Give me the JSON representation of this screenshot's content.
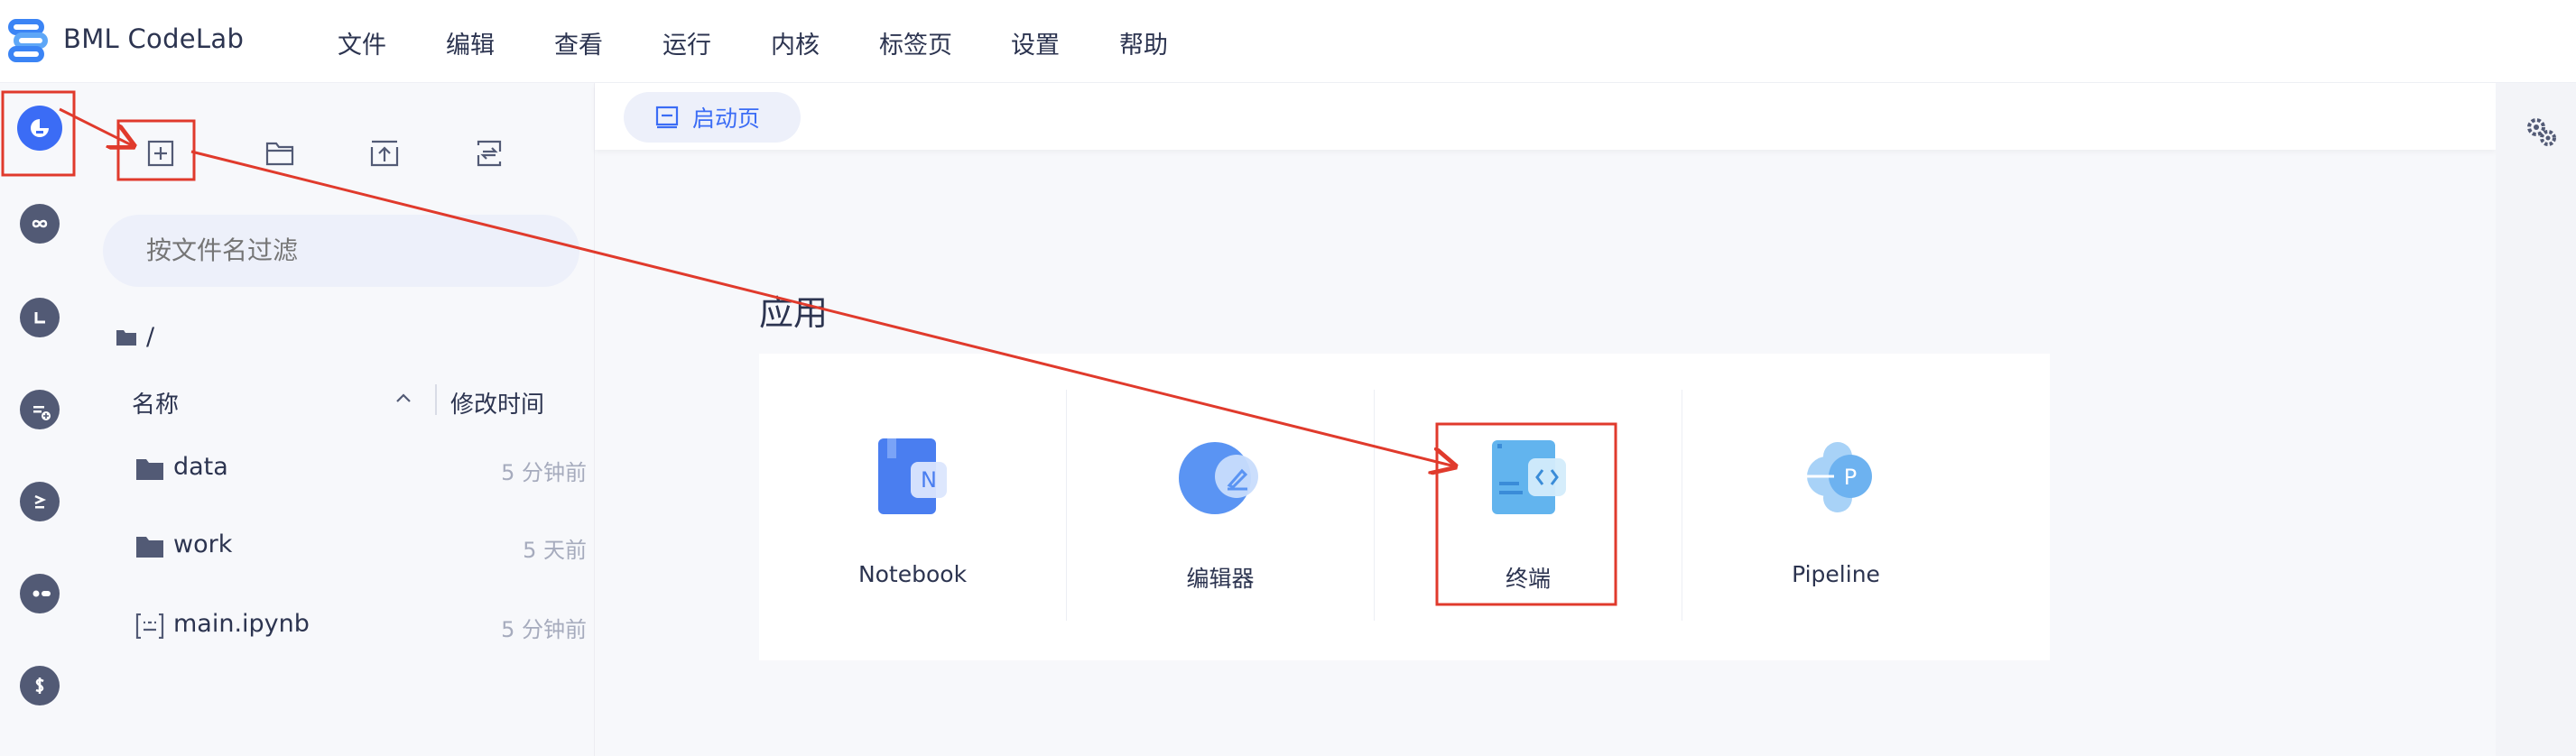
{
  "app": {
    "title": "BML CodeLab"
  },
  "menu": [
    "文件",
    "编辑",
    "查看",
    "运行",
    "内核",
    "标签页",
    "设置",
    "帮助"
  ],
  "activity_bar": {
    "icons": [
      "file-browser-icon",
      "infinity-icon",
      "corner-icon",
      "kernel-icon",
      "prompt-icon",
      "toggle-icon",
      "dollar-icon"
    ]
  },
  "file_browser": {
    "toolbar": [
      "new-launcher-icon",
      "new-folder-icon",
      "upload-icon",
      "refresh-icon"
    ],
    "search": {
      "placeholder": "按文件名过滤"
    },
    "breadcrumb": "/",
    "columns": {
      "name": "名称",
      "modified": "修改时间"
    },
    "files": [
      {
        "name": "data",
        "type": "folder",
        "modified": "5 分钟前"
      },
      {
        "name": "work",
        "type": "folder",
        "modified": "5 天前"
      },
      {
        "name": "main.ipynb",
        "type": "notebook",
        "modified": "5 分钟前"
      }
    ]
  },
  "tab": {
    "label": "启动页"
  },
  "launcher": {
    "section_title": "应用",
    "apps": [
      {
        "label": "Notebook",
        "icon": "notebook-icon"
      },
      {
        "label": "编辑器",
        "icon": "editor-icon"
      },
      {
        "label": "终端",
        "icon": "terminal-icon"
      },
      {
        "label": "Pipeline",
        "icon": "pipeline-icon"
      }
    ]
  },
  "annotations": {
    "color": "#e03a2c"
  },
  "colors": {
    "accent": "#3b6cf5",
    "text": "#2c3450",
    "muted": "#a6abbd"
  }
}
